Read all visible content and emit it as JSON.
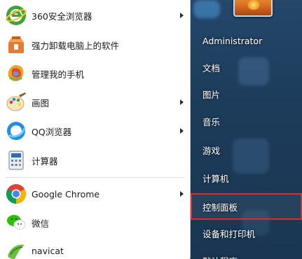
{
  "programs": [
    {
      "label": "360安全浏览器",
      "icon": "360-browser-icon",
      "submenu": true
    },
    {
      "label": "强力卸载电脑上的软件",
      "icon": "uninstall-box-icon",
      "submenu": false
    },
    {
      "label": "管理我的手机",
      "icon": "phone-manager-icon",
      "submenu": false
    },
    {
      "label": "画图",
      "icon": "paint-palette-icon",
      "submenu": true
    },
    {
      "label": "QQ浏览器",
      "icon": "qq-browser-icon",
      "submenu": true
    },
    {
      "label": "计算器",
      "icon": "calculator-icon",
      "submenu": false
    },
    {
      "label": "Google Chrome",
      "icon": "chrome-icon",
      "submenu": true
    },
    {
      "label": "微信",
      "icon": "wechat-icon",
      "submenu": false
    },
    {
      "label": "navicat",
      "icon": "navicat-icon",
      "submenu": false
    }
  ],
  "right_panel": {
    "items": [
      {
        "label": "Administrator"
      },
      {
        "label": "文档"
      },
      {
        "label": "图片"
      },
      {
        "label": "音乐"
      },
      {
        "label": "游戏"
      },
      {
        "label": "计算机"
      },
      {
        "label": "控制面板",
        "highlighted": true
      },
      {
        "label": "设备和打印机"
      },
      {
        "label": "默认程序"
      }
    ]
  },
  "colors": {
    "highlight_border": "#e02a2a",
    "panel_bg": "#1d3c5b",
    "list_bg": "#ffffff"
  }
}
